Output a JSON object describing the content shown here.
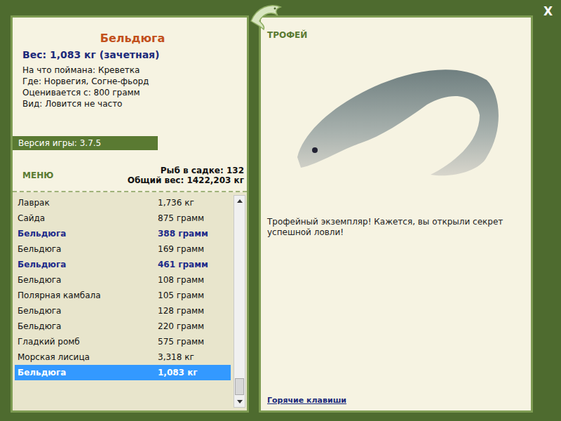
{
  "window": {
    "close": "X"
  },
  "fish": {
    "name": "Бельдюга",
    "weight": "Вес: 1,083 кг (зачетная)",
    "details": [
      "На что поймана: Креветка",
      "Где: Норвегия, Согне-фьорд",
      "Оценивается с: 800 грамм",
      "Вид: Ловится не часто"
    ]
  },
  "version": "Версия игры: 3.7.5",
  "menu": "МЕНЮ",
  "keepnet": {
    "count": "Рыб в садке: 132",
    "total": "Общий вес: 1422,203 кг"
  },
  "catch_list": [
    {
      "name": "Лаврак",
      "weight": "1,736 кг",
      "trophy": false,
      "selected": false
    },
    {
      "name": "Сайда",
      "weight": "875 грамм",
      "trophy": false,
      "selected": false
    },
    {
      "name": "Бельдюга",
      "weight": "388 грамм",
      "trophy": true,
      "selected": false
    },
    {
      "name": "Бельдюга",
      "weight": "169 грамм",
      "trophy": false,
      "selected": false
    },
    {
      "name": "Бельдюга",
      "weight": "461 грамм",
      "trophy": true,
      "selected": false
    },
    {
      "name": "Бельдюга",
      "weight": "108 грамм",
      "trophy": false,
      "selected": false
    },
    {
      "name": "Полярная камбала",
      "weight": "105 грамм",
      "trophy": false,
      "selected": false
    },
    {
      "name": "Бельдюга",
      "weight": "128 грамм",
      "trophy": false,
      "selected": false
    },
    {
      "name": "Бельдюга",
      "weight": "220 грамм",
      "trophy": false,
      "selected": false
    },
    {
      "name": "Гладкий ромб",
      "weight": "575 грамм",
      "trophy": false,
      "selected": false
    },
    {
      "name": "Морская лисица",
      "weight": "3,318 кг",
      "trophy": false,
      "selected": false
    },
    {
      "name": "Бельдюга",
      "weight": "1,083 кг",
      "trophy": false,
      "selected": true
    }
  ],
  "trophy": {
    "label": "ТРОФЕЙ",
    "message": "Трофейный экземпляр! Кажется, вы открыли секрет успешной ловли!"
  },
  "hotkeys_link": "Горячие клавиши"
}
